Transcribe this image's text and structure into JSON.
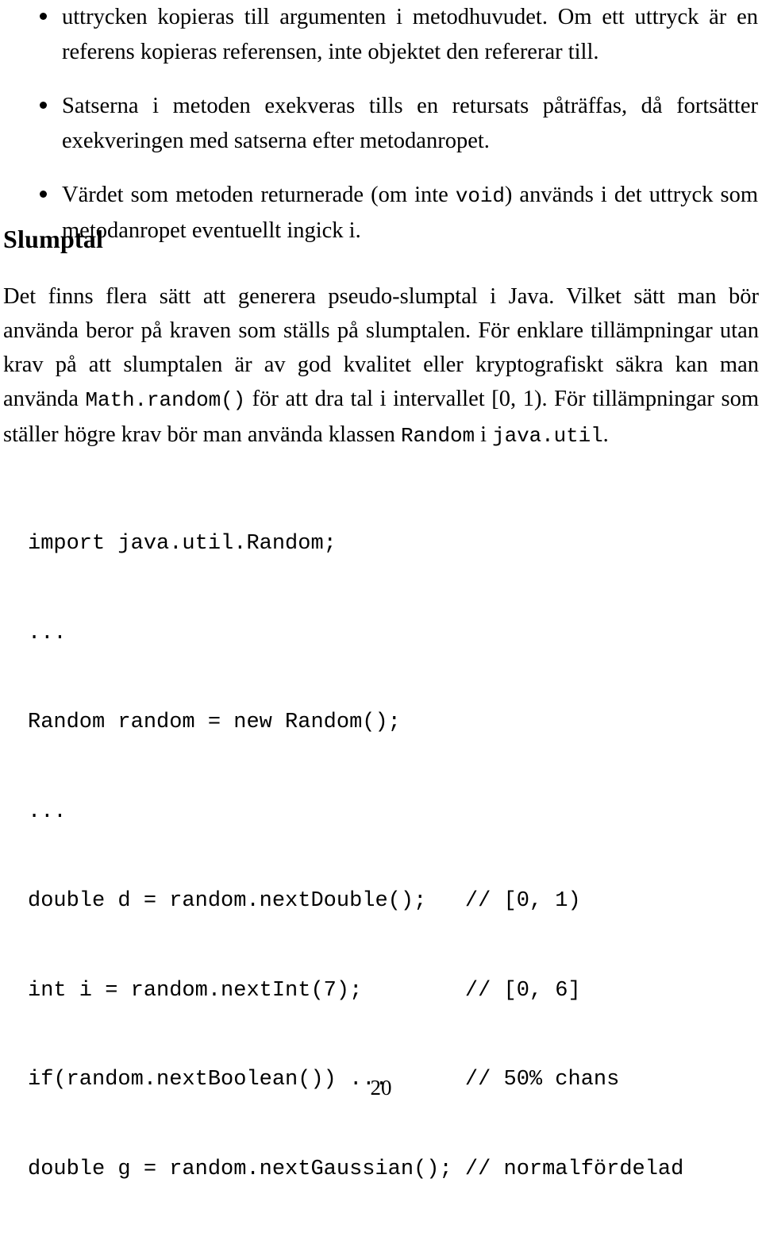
{
  "document": {
    "page_number": "20",
    "language": "sv"
  },
  "bullets": [
    {
      "text_before_code": "uttrycken kopieras till argumenten i metodhuvudet. Om ett uttryck är en referens kopieras referensen, inte objektet den refererar till.",
      "code": "",
      "text_after_code": ""
    },
    {
      "text_before_code": "Satserna i metoden exekveras tills en retursats påträffas, då fortsätter exekveringen med satserna efter metodanropet.",
      "code": "",
      "text_after_code": ""
    },
    {
      "text_before_code": "Värdet som metoden returnerade (om inte ",
      "code": "void",
      "text_after_code": ") används i det uttryck som metodanropet eventuellt ingick i."
    }
  ],
  "section": {
    "heading": "Slumptal",
    "paragraph": {
      "part1": "Det finns flera sätt att generera pseudo-slumptal i Java. Vilket sätt man bör använda beror på kraven som ställs på slumptalen. För enklare tillämpningar utan krav på att slumptalen är av god kvalitet eller kryptografiskt säkra kan man använda ",
      "code1": "Math.random()",
      "part2": " för att dra tal i intervallet ",
      "interval": "[0, 1)",
      "part3": ". För tillämpningar som ställer högre krav bör man använda klassen ",
      "code2": "Random",
      "part4": " i ",
      "code3": "java.util",
      "part5": "."
    }
  },
  "code_block": {
    "lines": [
      "import java.util.Random;",
      "...",
      "Random random = new Random();",
      "...",
      "double d = random.nextDouble();   // [0, 1)",
      "int i = random.nextInt(7);        // [0, 6]",
      "if(random.nextBoolean()) ...      // 50% chans",
      "double g = random.nextGaussian(); // normalfördelad"
    ]
  }
}
